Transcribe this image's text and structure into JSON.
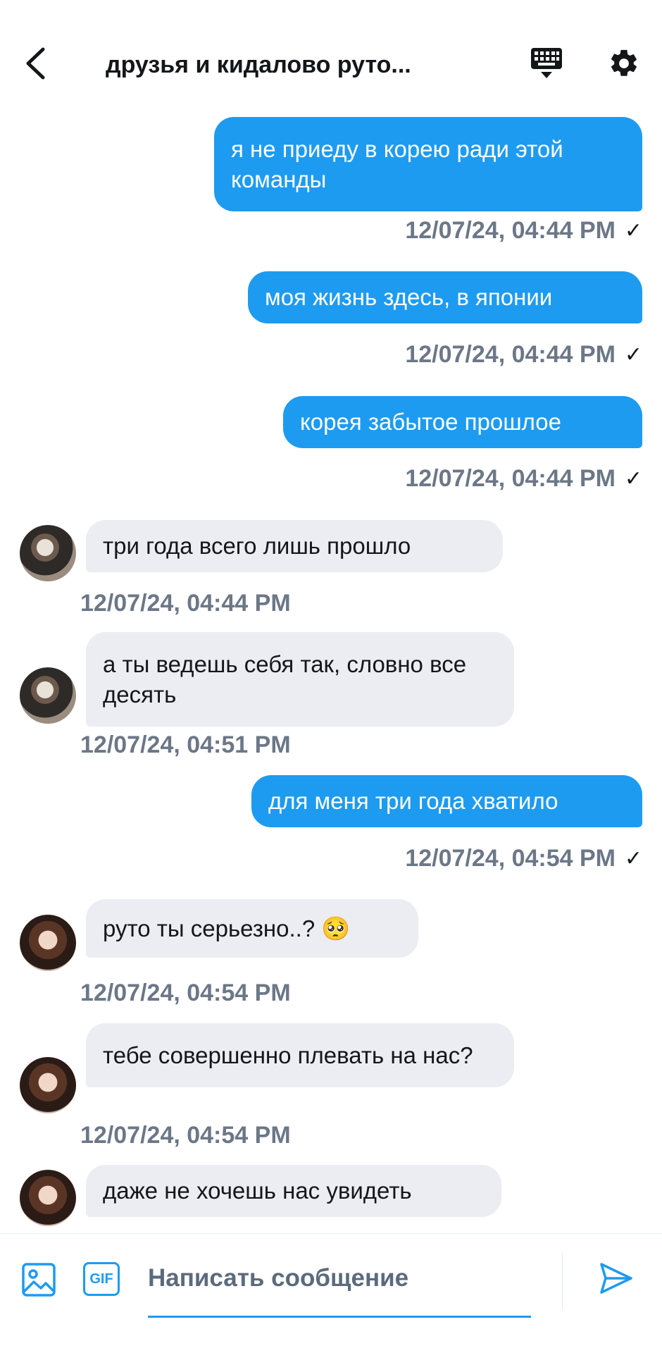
{
  "header": {
    "title": "друзья и кидалово руто...",
    "icons": {
      "back": "chevron-left-icon",
      "keyboard": "keyboard-icon",
      "settings": "gear-icon"
    }
  },
  "colors": {
    "accent": "#1d9bf0",
    "incoming_bubble": "#ebedf2",
    "timestamp": "#6c7787"
  },
  "messages": [
    {
      "direction": "out",
      "text": "я не приеду в корею ради этой команды",
      "time": "12/07/24, 04:44 PM",
      "status": "✓"
    },
    {
      "direction": "out",
      "text": "моя жизнь здесь, в японии",
      "time": "12/07/24, 04:44 PM",
      "status": "✓"
    },
    {
      "direction": "out",
      "text": "корея забытое прошлое",
      "time": "12/07/24, 04:44 PM",
      "status": "✓"
    },
    {
      "direction": "in",
      "text": "три года всего лишь прошло",
      "time": "12/07/24, 04:44 PM"
    },
    {
      "direction": "in",
      "text": "а ты ведешь себя так, словно все десять",
      "time": "12/07/24, 04:51 PM"
    },
    {
      "direction": "out",
      "text": "для меня три года хватило",
      "time": "12/07/24, 04:54 PM",
      "status": "✓"
    },
    {
      "direction": "in",
      "text": "руто ты серьезно..? 🥺",
      "time": "12/07/24, 04:54 PM"
    },
    {
      "direction": "in",
      "text": "тебе совершенно плевать на нас?",
      "time": "12/07/24, 04:54 PM"
    },
    {
      "direction": "in",
      "text": "даже не хочешь нас увидеть",
      "time": ""
    }
  ],
  "composer": {
    "gif_label": "GIF",
    "placeholder": "Написать сообщение",
    "icons": {
      "image": "image-icon",
      "gif": "gif-icon",
      "send": "send-icon"
    }
  }
}
